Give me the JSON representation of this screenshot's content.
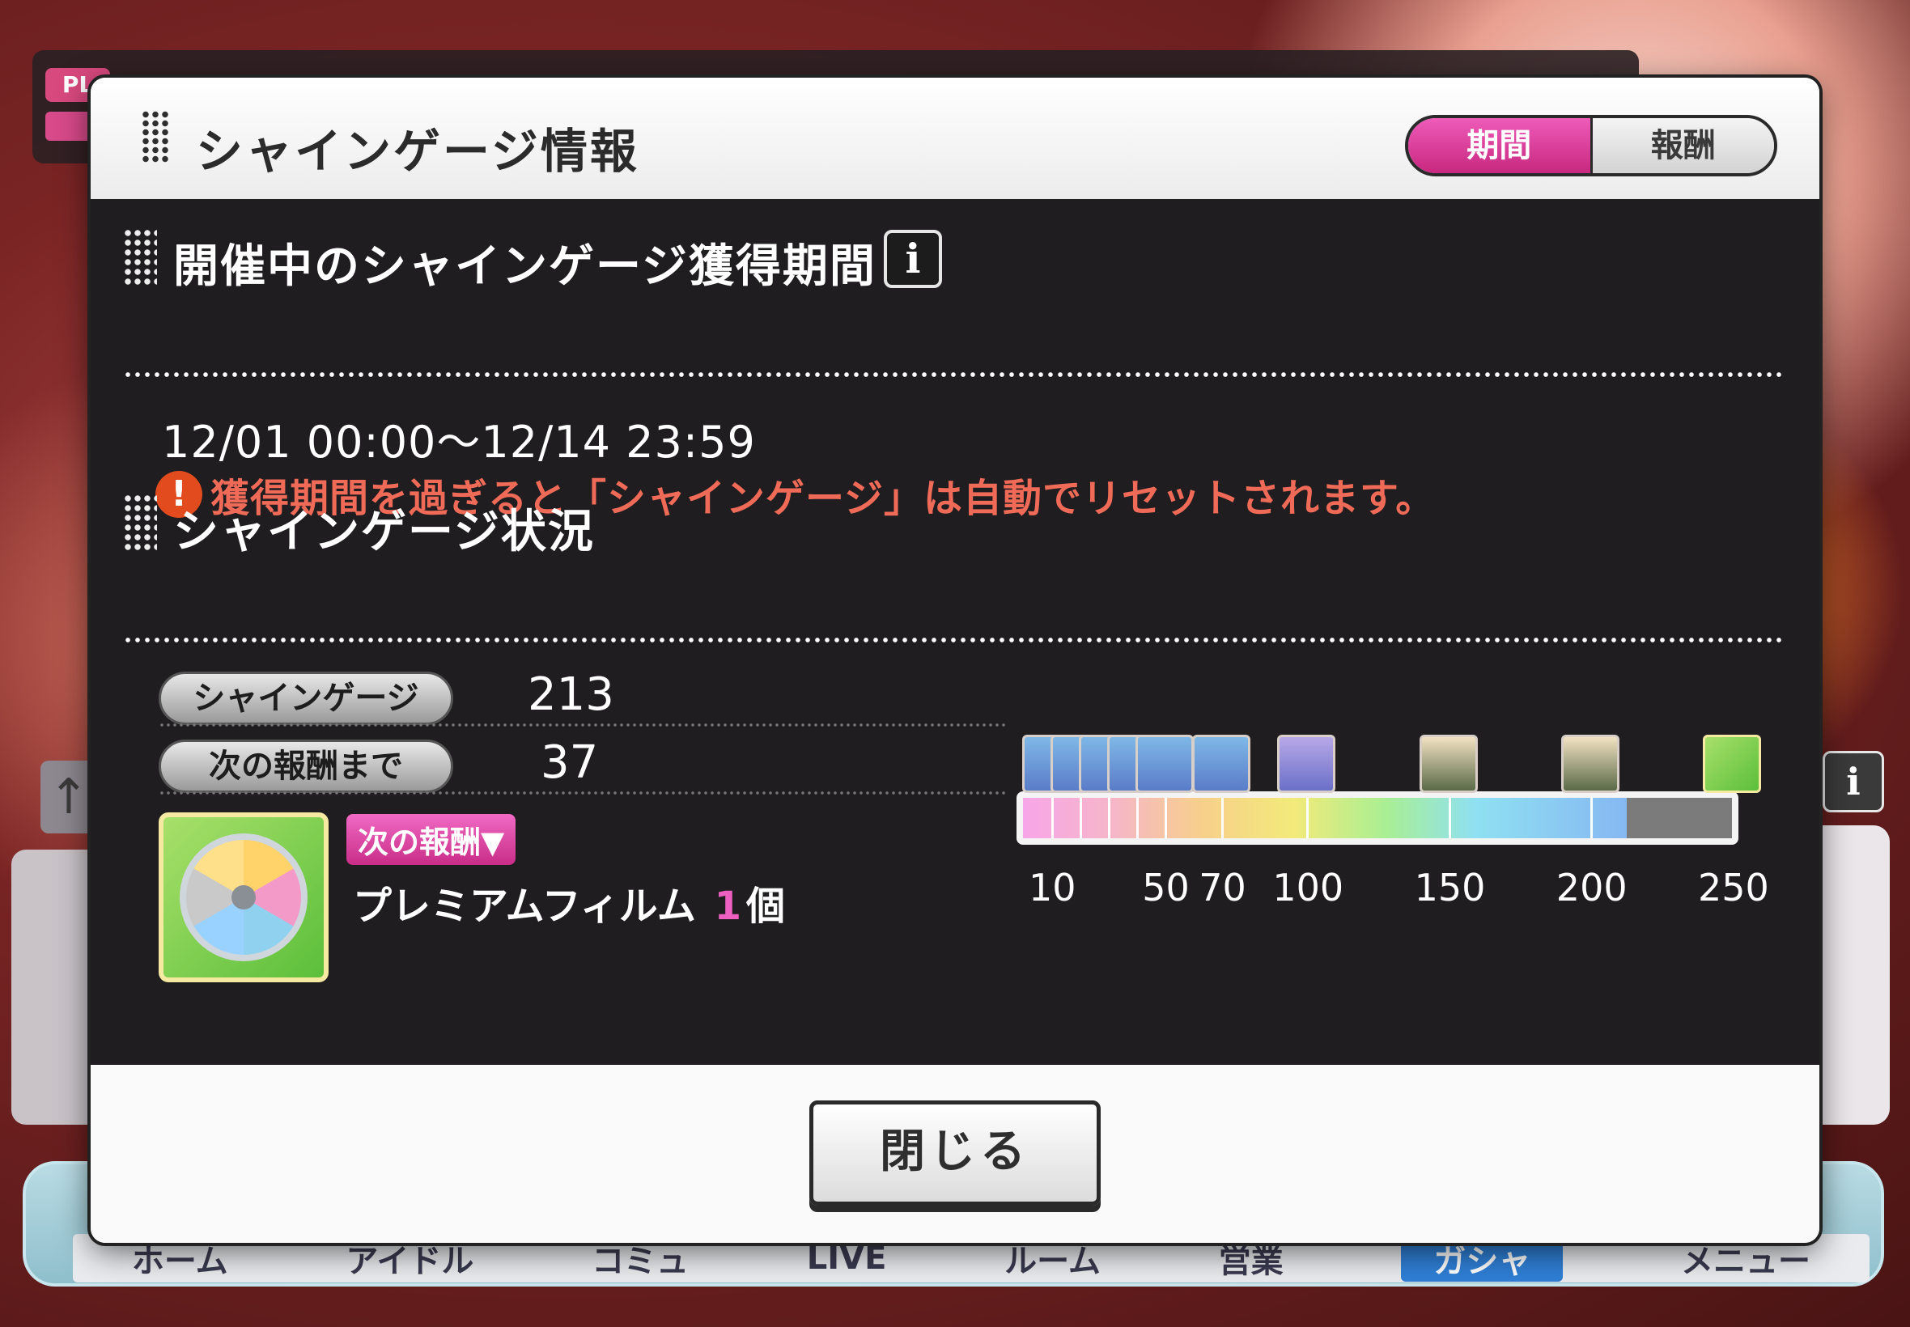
{
  "background": {
    "pl_badge": "PL",
    "nav": [
      "ホーム",
      "アイドル",
      "コミュ",
      "LIVE",
      "ルーム",
      "営業",
      "ガシャ",
      "メニュー"
    ],
    "nav_active": "ガシャ"
  },
  "modal": {
    "title": "シャインゲージ情報",
    "tabs": [
      {
        "label": "期間",
        "active": true
      },
      {
        "label": "報酬",
        "active": false
      }
    ],
    "period_section": {
      "heading": "開催中のシャインゲージ獲得期間",
      "info_icon": "i",
      "period": "12/01 00:00～12/14 23:59",
      "warning": "獲得期間を過ぎると「シャインゲージ」は自動でリセットされます。",
      "warning_icon": "!"
    },
    "status_section": {
      "heading": "シャインゲージ状況",
      "gauge_label": "シャインゲージ",
      "gauge_value": "213",
      "next_label": "次の報酬まで",
      "next_value": "37",
      "next_reward_tag": "次の報酬▼",
      "next_reward_name": "プレミアムフィルム",
      "next_reward_qty": "1",
      "next_reward_unit": "個",
      "gauge": {
        "current": 213,
        "max": 250,
        "milestones": [
          10,
          20,
          30,
          40,
          50,
          70,
          100,
          150,
          200,
          250
        ],
        "labels": [
          "10",
          "50",
          "70",
          "100",
          "150",
          "200",
          "250"
        ]
      }
    },
    "close_label": "閉じる"
  }
}
